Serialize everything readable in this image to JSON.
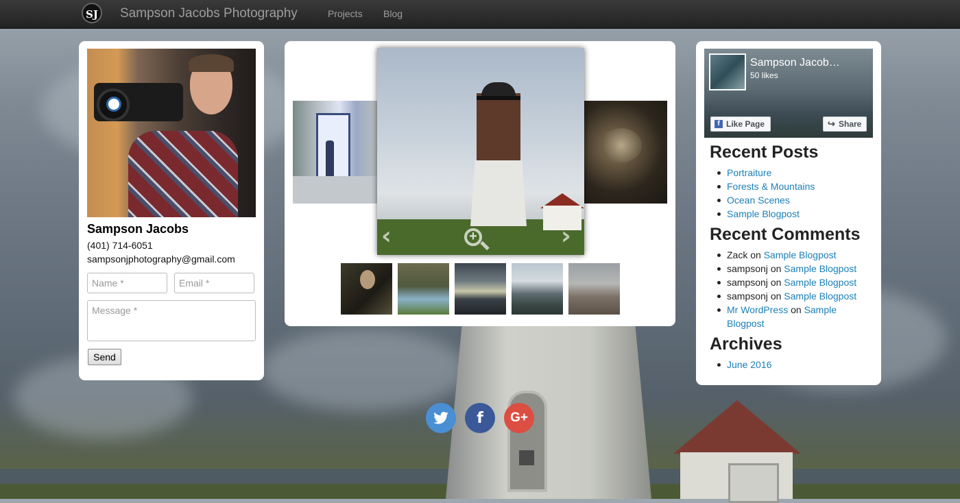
{
  "navbar": {
    "logo_text": "SJ",
    "brand": "Sampson Jacobs Photography",
    "links": [
      "Projects",
      "Blog"
    ]
  },
  "profile": {
    "name": "Sampson Jacobs",
    "phone": "(401) 714-6051",
    "email": "sampsonjphotography@gmail.com",
    "form": {
      "name_placeholder": "Name *",
      "email_placeholder": "Email *",
      "message_placeholder": "Message *",
      "send_label": "Send"
    }
  },
  "facebook": {
    "page_name": "Sampson Jacob…",
    "likes": "50 likes",
    "like_label": "Like Page",
    "share_label": "Share"
  },
  "recent_posts": {
    "title": "Recent Posts",
    "items": [
      "Portraiture",
      "Forests & Mountains",
      "Ocean Scenes",
      "Sample Blogpost"
    ]
  },
  "recent_comments": {
    "title": "Recent Comments",
    "items": [
      {
        "author": "Zack",
        "on": "on",
        "post": "Sample Blogpost"
      },
      {
        "author": "sampsonj",
        "on": "on",
        "post": "Sample Blogpost"
      },
      {
        "author": "sampsonj",
        "on": "on",
        "post": "Sample Blogpost"
      },
      {
        "author": "sampsonj",
        "on": "on",
        "post": "Sample Blogpost"
      },
      {
        "author": "Mr WordPress",
        "on": "on",
        "post": "Sample Blogpost"
      }
    ]
  },
  "archives": {
    "title": "Archives",
    "items": [
      "June 2016"
    ]
  },
  "social": {
    "twitter_color": "#4a8fd3",
    "facebook_color": "#3b5998",
    "google_color": "#dc4e41",
    "google_label": "G+"
  }
}
